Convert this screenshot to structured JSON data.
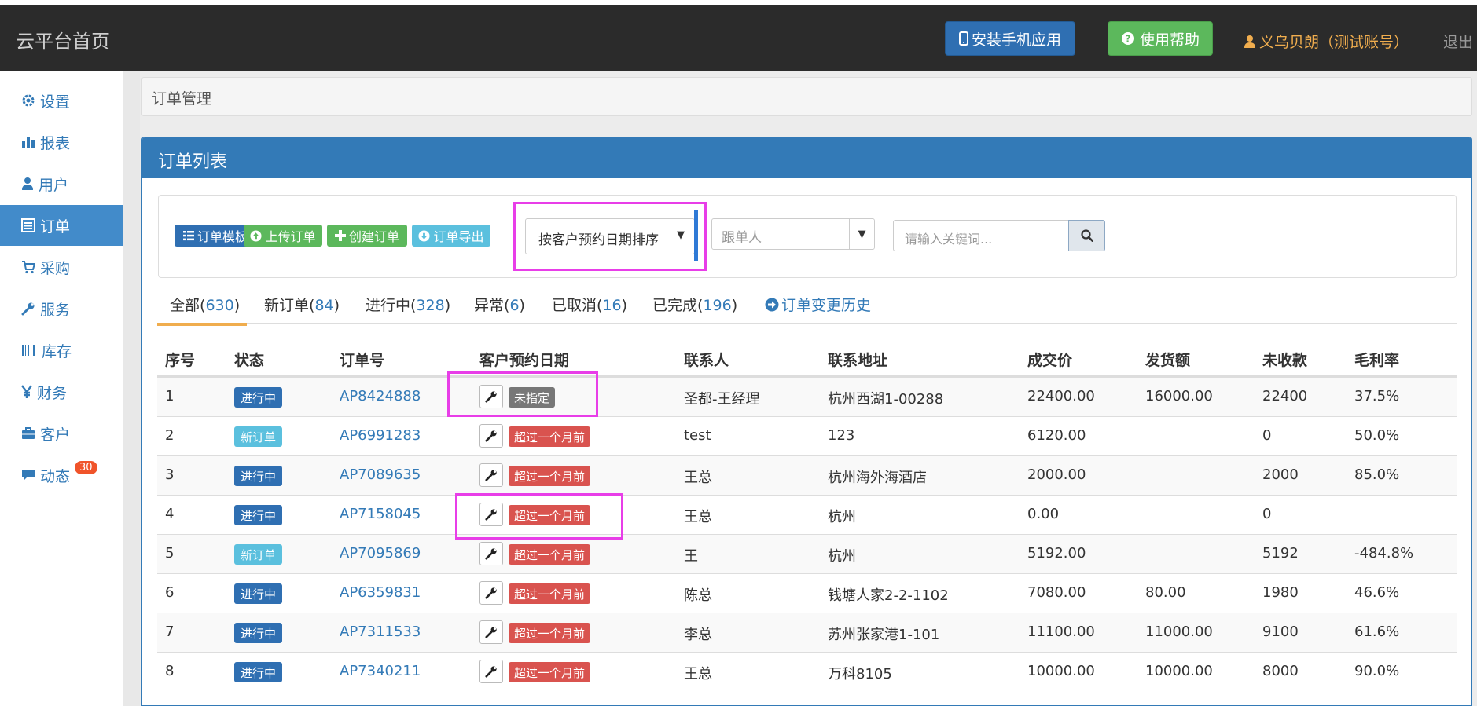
{
  "header": {
    "brand": "云平台首页",
    "install_label": "安装手机应用",
    "help_label": "使用帮助",
    "user_label": "义乌贝朗（测试账号）",
    "logout_label": "退出"
  },
  "sidebar": {
    "items": [
      {
        "label": "设置",
        "icon": "gear-icon"
      },
      {
        "label": "报表",
        "icon": "bar-chart-icon"
      },
      {
        "label": "用户",
        "icon": "user-icon"
      },
      {
        "label": "订单",
        "icon": "list-icon",
        "active": true
      },
      {
        "label": "采购",
        "icon": "cart-icon"
      },
      {
        "label": "服务",
        "icon": "wrench-icon"
      },
      {
        "label": "库存",
        "icon": "barcode-icon"
      },
      {
        "label": "财务",
        "icon": "yen-icon"
      },
      {
        "label": "客户",
        "icon": "briefcase-icon"
      },
      {
        "label": "动态",
        "icon": "comment-icon",
        "badge": "30"
      }
    ]
  },
  "breadcrumb": "订单管理",
  "panel": {
    "title": "订单列表"
  },
  "toolbar": {
    "template_label": "订单模板",
    "upload_label": "上传订单",
    "create_label": "创建订单",
    "export_label": "订单导出",
    "sort_value": "按客户预约日期排序",
    "follower_placeholder": "跟单人",
    "search_placeholder": "请输入关键词..."
  },
  "tabs": [
    {
      "label": "全部",
      "count": "630",
      "active": true
    },
    {
      "label": "新订单",
      "count": "84"
    },
    {
      "label": "进行中",
      "count": "328"
    },
    {
      "label": "异常",
      "count": "6"
    },
    {
      "label": "已取消",
      "count": "16"
    },
    {
      "label": "已完成",
      "count": "196"
    }
  ],
  "history_label": "订单变更历史",
  "table": {
    "headers": [
      "序号",
      "状态",
      "订单号",
      "客户预约日期",
      "联系人",
      "联系地址",
      "成交价",
      "发货额",
      "未收款",
      "毛利率"
    ],
    "rows": [
      {
        "no": "1",
        "status": "进行中",
        "status_type": "ongoing",
        "order": "AP8424888",
        "date": "未指定",
        "date_type": "gray",
        "contact": "圣都-王经理",
        "address": "杭州西湖1-00288",
        "price": "22400.00",
        "shipped": "16000.00",
        "unpaid": "22400",
        "margin": "37.5%"
      },
      {
        "no": "2",
        "status": "新订单",
        "status_type": "new",
        "order": "AP6991283",
        "date": "超过一个月前",
        "date_type": "red",
        "contact": "test",
        "address": "123",
        "price": "6120.00",
        "shipped": "",
        "unpaid": "0",
        "margin": "50.0%"
      },
      {
        "no": "3",
        "status": "进行中",
        "status_type": "ongoing",
        "order": "AP7089635",
        "date": "超过一个月前",
        "date_type": "red",
        "contact": "王总",
        "address": "杭州海外海酒店",
        "price": "2000.00",
        "shipped": "",
        "unpaid": "2000",
        "margin": "85.0%"
      },
      {
        "no": "4",
        "status": "进行中",
        "status_type": "ongoing",
        "order": "AP7158045",
        "date": "超过一个月前",
        "date_type": "red",
        "contact": "王总",
        "address": "杭州",
        "price": "0.00",
        "shipped": "",
        "unpaid": "0",
        "margin": ""
      },
      {
        "no": "5",
        "status": "新订单",
        "status_type": "new",
        "order": "AP7095869",
        "date": "超过一个月前",
        "date_type": "red",
        "contact": "王",
        "address": "杭州",
        "price": "5192.00",
        "shipped": "",
        "unpaid": "5192",
        "margin": "-484.8%"
      },
      {
        "no": "6",
        "status": "进行中",
        "status_type": "ongoing",
        "order": "AP6359831",
        "date": "超过一个月前",
        "date_type": "red",
        "contact": "陈总",
        "address": "钱塘人家2-2-1102",
        "price": "7080.00",
        "shipped": "80.00",
        "unpaid": "1980",
        "margin": "46.6%"
      },
      {
        "no": "7",
        "status": "进行中",
        "status_type": "ongoing",
        "order": "AP7311533",
        "date": "超过一个月前",
        "date_type": "red",
        "contact": "李总",
        "address": "苏州张家港1-101",
        "price": "11100.00",
        "shipped": "11000.00",
        "unpaid": "9100",
        "margin": "61.6%"
      },
      {
        "no": "8",
        "status": "进行中",
        "status_type": "ongoing",
        "order": "AP7340211",
        "date": "超过一个月前",
        "date_type": "red",
        "contact": "王总",
        "address": "万科8105",
        "price": "10000.00",
        "shipped": "10000.00",
        "unpaid": "8000",
        "margin": "90.0%"
      }
    ]
  }
}
